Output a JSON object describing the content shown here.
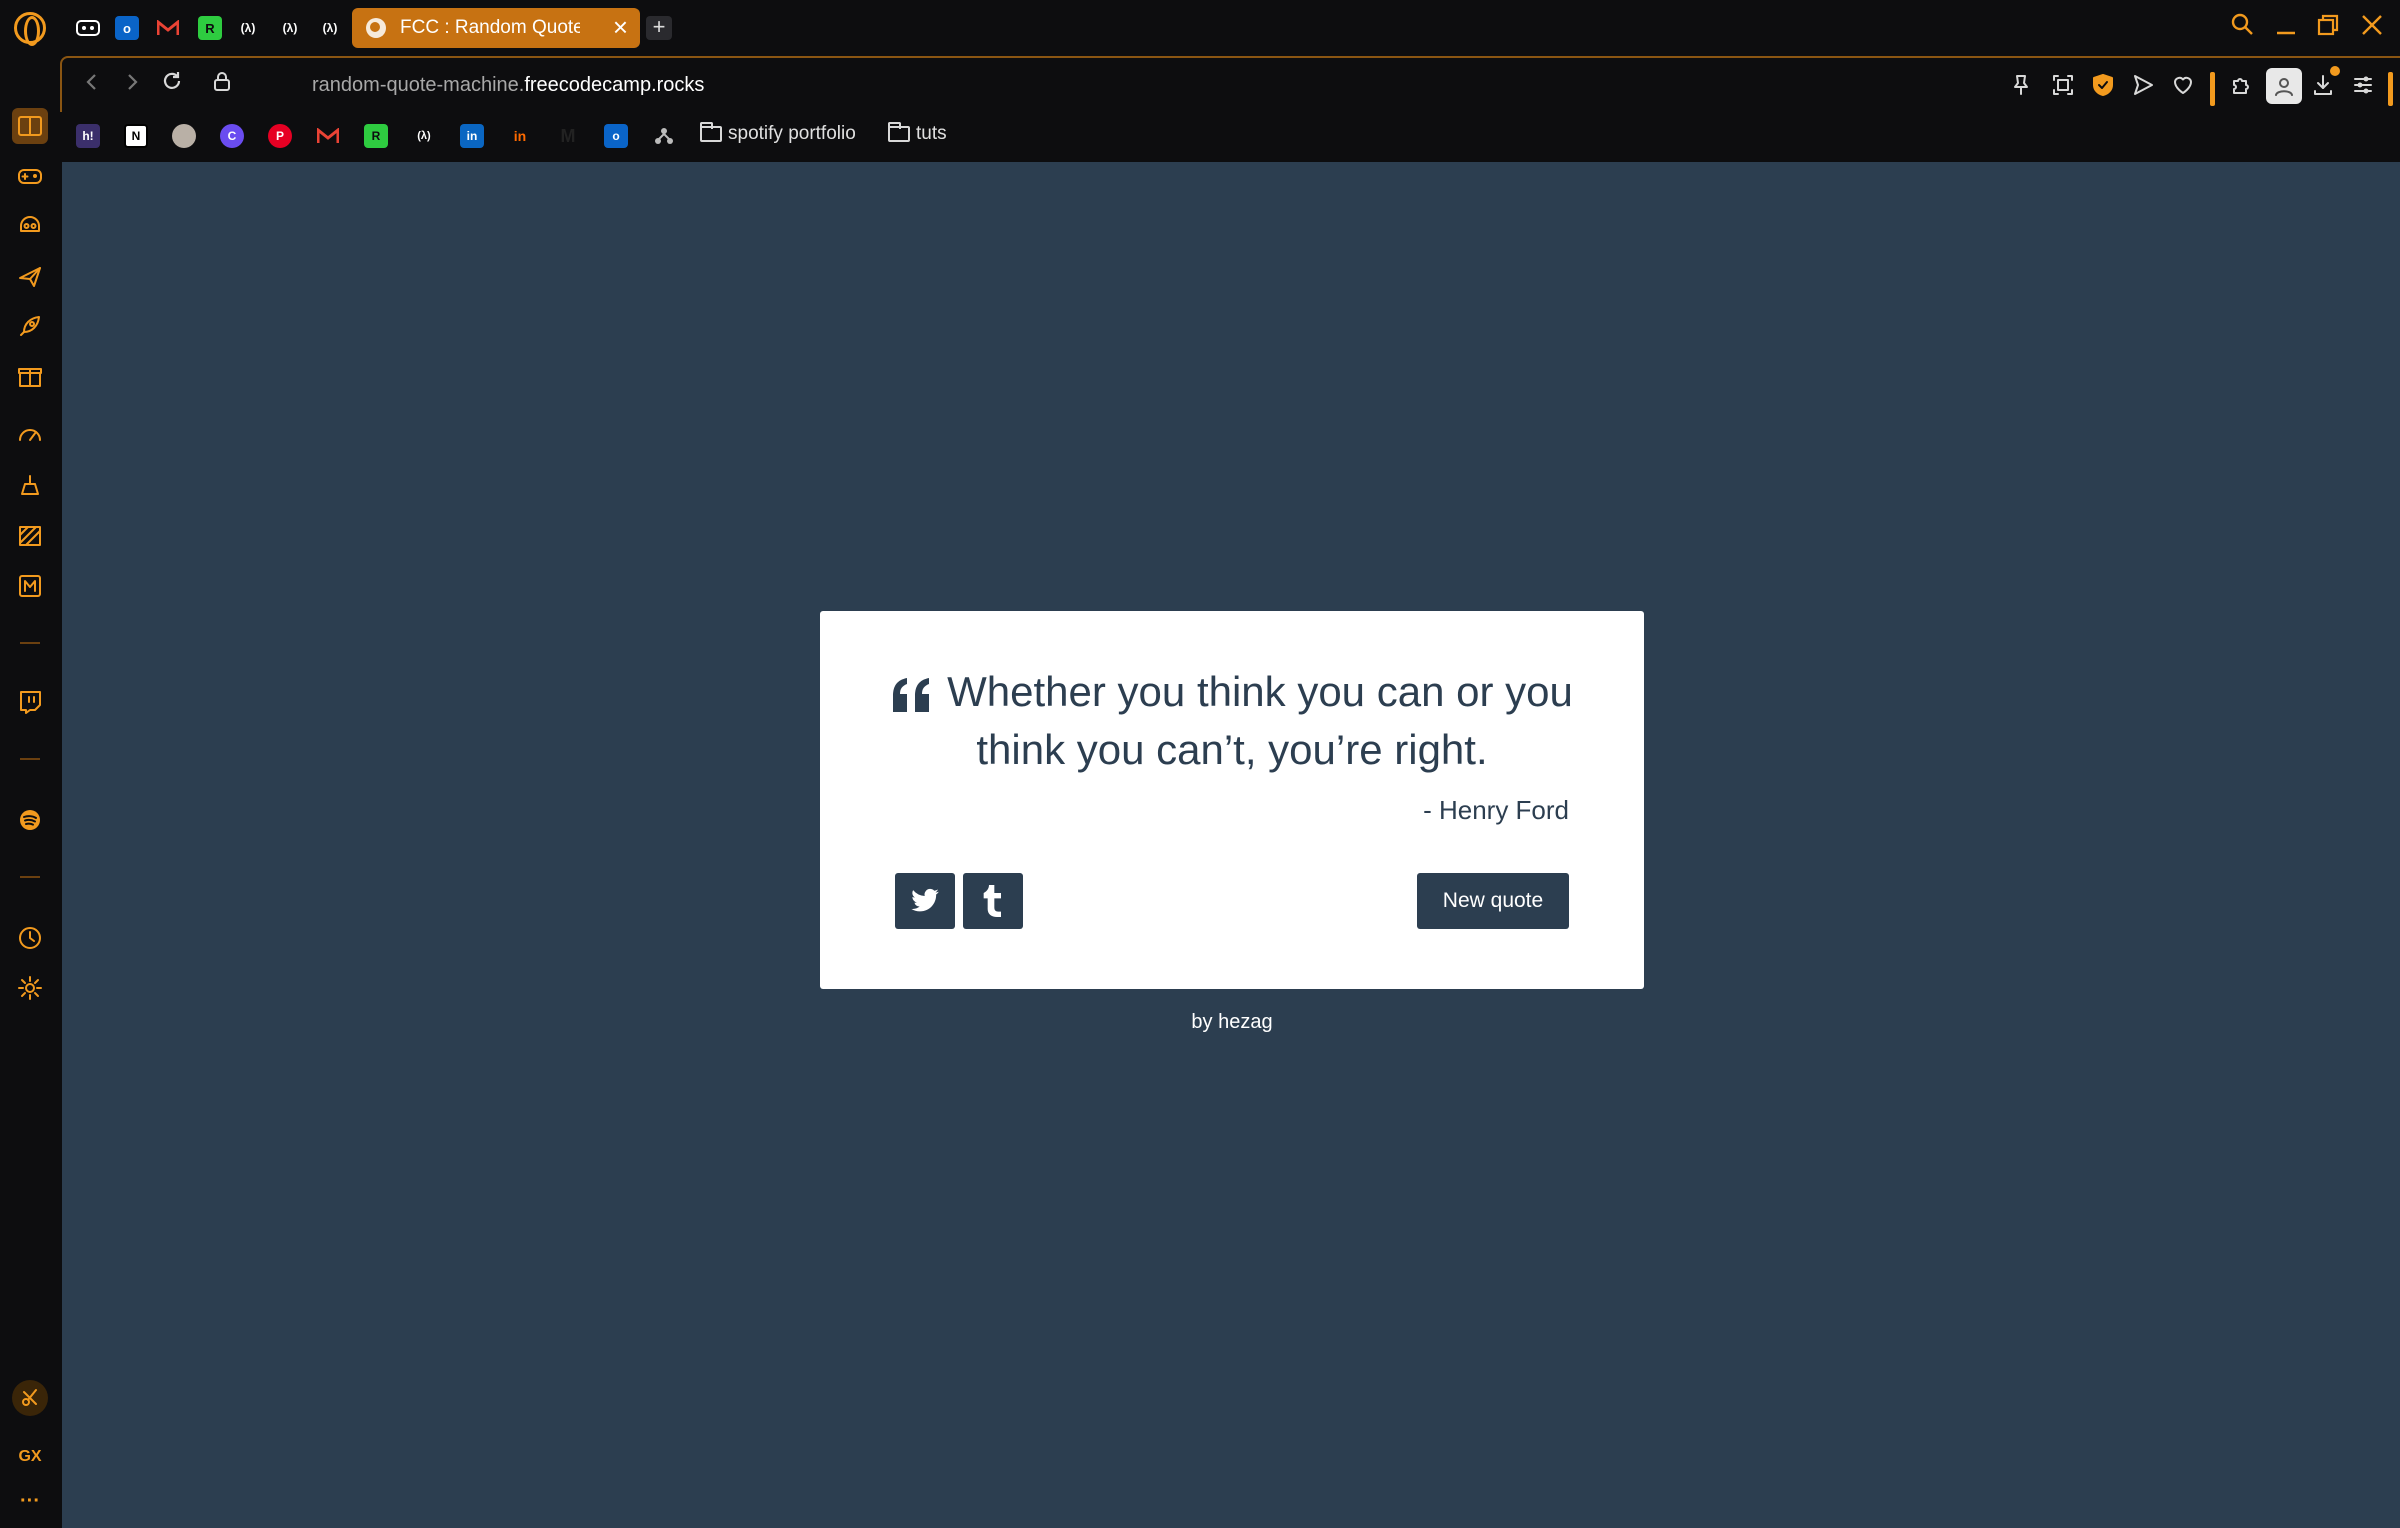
{
  "tabs": {
    "active_title": "FCC : Random Quote Machine",
    "close_glyph": "×",
    "new_tab_glyph": "+",
    "pinned": [
      {
        "name": "gamepad-tab-icon",
        "label": "",
        "color": "#222222"
      },
      {
        "name": "outlook-tab-icon",
        "label": "o",
        "color": "#0a64c8"
      },
      {
        "name": "gmail-tab-icon",
        "label": "M",
        "color": "#0d0d0f"
      },
      {
        "name": "rk-tab-icon",
        "label": "R",
        "color": "#2ecc40"
      },
      {
        "name": "fcc-tab-icon-1",
        "label": "(λ)",
        "color": "#0d0d0f"
      },
      {
        "name": "fcc-tab-icon-2",
        "label": "(λ)",
        "color": "#0d0d0f"
      },
      {
        "name": "fcc-tab-icon-3",
        "label": "(λ)",
        "color": "#0d0d0f"
      }
    ]
  },
  "address": {
    "url_prefix": "random-quote-machine.",
    "url_host": "freecodecamp.rocks"
  },
  "bookmarks": {
    "folders": [
      "spotify portfolio",
      "tuts"
    ]
  },
  "quote": {
    "text": "Whether you think you can or you think you can’t, you’re right.",
    "author": "- Henry Ford",
    "new_quote_label": "New quote"
  },
  "footer": {
    "by": "by",
    "author_link": "hezag"
  },
  "sidebar": {
    "bottom_label": "GX",
    "more_glyph": "···"
  },
  "colors": {
    "accent": "#f29a1e",
    "page_bg": "#2c3e50",
    "card_bg": "#ffffff",
    "active_tab": "#c77212"
  }
}
